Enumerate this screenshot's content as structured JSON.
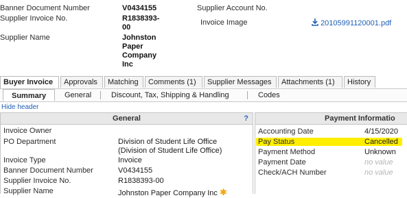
{
  "header": {
    "banner_doc_label": "Banner Document Number",
    "banner_doc_value": "V0434155",
    "supplier_invoice_label": "Supplier Invoice No.",
    "supplier_invoice_value": "R1838393-\n00",
    "supplier_name_label": "Supplier Name",
    "supplier_name_value": "Johnston\nPaper\nCompany\nInc",
    "supplier_account_label": "Supplier Account No.",
    "invoice_image_label": "Invoice Image",
    "invoice_image_file": "20105991120001.pdf"
  },
  "tabs": [
    "Buyer Invoice",
    "Approvals",
    "Matching",
    "Comments (1)",
    "Supplier Messages",
    "Attachments (1)",
    "History"
  ],
  "subtabs": [
    "Summary",
    "General",
    "Discount, Tax, Shipping & Handling",
    "Codes"
  ],
  "hide_header": "Hide header",
  "general": {
    "title": "General",
    "help": "?",
    "rows": [
      {
        "label": "Invoice Owner",
        "value": ""
      },
      {
        "label": "PO Department",
        "value": "Division of Student Life Office\n(Division of Student Life Office)"
      },
      {
        "label": "Invoice Type",
        "value": "Invoice"
      },
      {
        "label": "Banner Document Number",
        "value": "V0434155"
      },
      {
        "label": "Supplier Invoice No.",
        "value": "R1838393-00"
      },
      {
        "label": "Supplier Name",
        "value": "Johnston Paper Company Inc"
      }
    ]
  },
  "payment": {
    "title": "Payment Informatio",
    "rows": [
      {
        "label": "Accounting Date",
        "value": "4/15/2020"
      },
      {
        "label": "Pay Status",
        "value": "Cancelled"
      },
      {
        "label": "Payment Method",
        "value": "Unknown"
      },
      {
        "label": "Payment Date",
        "value": "no value"
      },
      {
        "label": "Check/ACH Number",
        "value": "no value"
      }
    ]
  },
  "colors": {
    "highlight": "#ffee00",
    "link": "#1f5fb4",
    "required_star": "#f5a300"
  }
}
